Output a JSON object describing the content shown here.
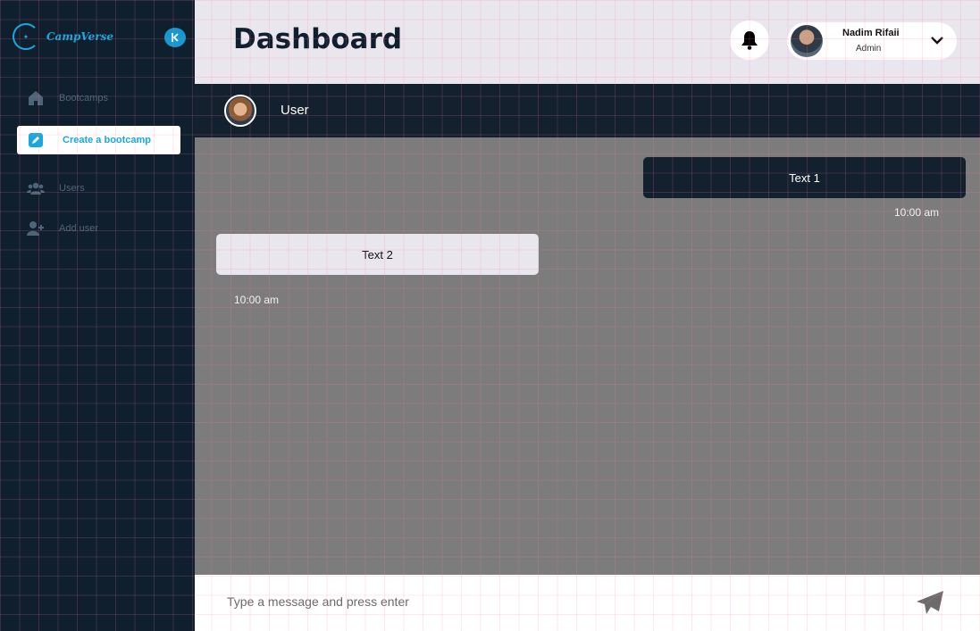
{
  "brand": {
    "name": "CampVerse",
    "logo_mark": "✦",
    "collapse_icon": "chevron-left-icon"
  },
  "sidebar": {
    "items": [
      {
        "label": "Bootcamps",
        "icon": "home-icon",
        "active": false
      },
      {
        "label": "Create a bootcamp",
        "icon": "edit-icon",
        "active": true
      },
      {
        "label": "Users",
        "icon": "users-icon",
        "active": false
      },
      {
        "label": "Add user",
        "icon": "add-user-icon",
        "active": false
      }
    ]
  },
  "header": {
    "title": "Dashboard",
    "user": {
      "name": "Nadim Rifaii",
      "role": "Admin"
    }
  },
  "chat": {
    "contact_name": "User",
    "messages": [
      {
        "text": "Text 1",
        "time": "10:00 am",
        "direction": "sent"
      },
      {
        "text": "Text 2",
        "time": "10:00 am",
        "direction": "received"
      }
    ],
    "input_placeholder": "Type a message and press enter"
  },
  "colors": {
    "sidebar_bg": "#0f1f2e",
    "accent": "#18a8e0",
    "header_bg": "#e9e6ee",
    "chat_area_bg": "#7c7c7c",
    "sent_bubble": "#13212f",
    "received_bubble": "#e9e6ee"
  }
}
